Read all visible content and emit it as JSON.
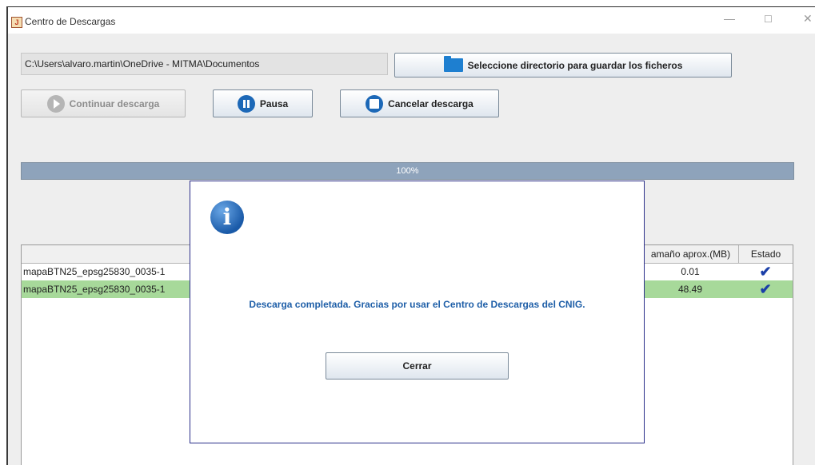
{
  "window": {
    "title": "Centro de Descargas",
    "controls": {
      "minimize": "—",
      "maximize": "☐",
      "close": "✕"
    }
  },
  "directory": {
    "path": "C:\\Users\\alvaro.martin\\OneDrive - MITMA\\Documentos",
    "select_button": "Seleccione directorio para guardar los ficheros"
  },
  "actions": {
    "continue_label": "Continuar descarga",
    "continue_enabled": false,
    "pause_label": "Pausa",
    "cancel_label": "Cancelar descarga"
  },
  "progress": {
    "label": "100%",
    "value": 100
  },
  "table": {
    "columns": [
      "",
      "amaño aprox.(MB)",
      "Estado"
    ],
    "rows": [
      {
        "name": "mapaBTN25_epsg25830_0035-1",
        "size": "0.01",
        "status": "✔",
        "selected": false
      },
      {
        "name": "mapaBTN25_epsg25830_0035-1",
        "size": "48.49",
        "status": "✔",
        "selected": true
      }
    ]
  },
  "dialog": {
    "icon": "info-icon",
    "message": "Descarga completada. Gracias por usar el Centro de Descargas del CNIG.",
    "close_label": "Cerrar"
  },
  "colors": {
    "accent": "#1c68b7",
    "progress_fill": "#8ea3bb",
    "selected_row": "#a7d99a",
    "message_text": "#1f5fa8"
  }
}
